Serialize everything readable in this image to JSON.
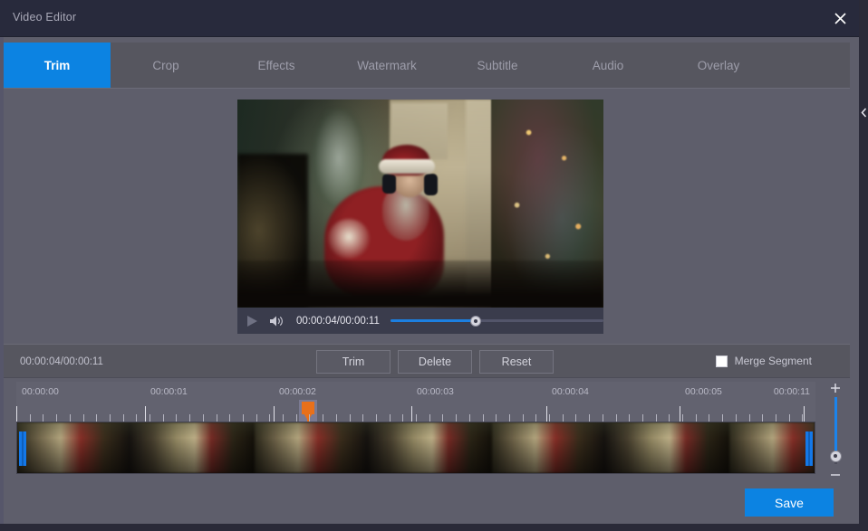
{
  "window": {
    "title": "Video Editor",
    "close_icon": "close-icon",
    "collapse_icon": "chevron-left-icon"
  },
  "tabs": [
    {
      "label": "Trim",
      "active": true
    },
    {
      "label": "Crop",
      "active": false
    },
    {
      "label": "Effects",
      "active": false
    },
    {
      "label": "Watermark",
      "active": false
    },
    {
      "label": "Subtitle",
      "active": false
    },
    {
      "label": "Audio",
      "active": false
    },
    {
      "label": "Overlay",
      "active": false
    }
  ],
  "player": {
    "play_icon": "play-icon",
    "volume_icon": "volume-icon",
    "time_display": "00:00:04/00:00:11",
    "current_time": "00:00:04",
    "total_time": "00:00:11",
    "progress_percent": 40
  },
  "toolbar": {
    "time_display": "00:00:04/00:00:11",
    "trim_label": "Trim",
    "delete_label": "Delete",
    "reset_label": "Reset",
    "merge_segment_label": "Merge Segment",
    "merge_segment_checked": false
  },
  "timeline": {
    "ruler_labels": [
      {
        "text": "00:00:00",
        "percent": 0
      },
      {
        "text": "00:00:01",
        "percent": 16.1
      },
      {
        "text": "00:00:02",
        "percent": 32.2
      },
      {
        "text": "00:00:03",
        "percent": 49.4
      },
      {
        "text": "00:00:04",
        "percent": 66.3
      },
      {
        "text": "00:00:05",
        "percent": 83.0
      },
      {
        "text": "00:00:11",
        "percent": 98.5
      }
    ],
    "playhead_percent": 36.5,
    "trim_start_percent": 0,
    "trim_end_percent": 100,
    "zoom_plus_label": "+",
    "zoom_minus_label": "–",
    "zoom_value_percent": 88
  },
  "footer": {
    "save_label": "Save"
  },
  "colors": {
    "accent_blue": "#0c83e2",
    "panel_bg": "#5e5e6b",
    "titlebar_bg": "#282a3c",
    "tabbar_bg": "#56565f",
    "playhead_orange": "#e8701a",
    "trim_handle_blue": "#1478e8"
  }
}
